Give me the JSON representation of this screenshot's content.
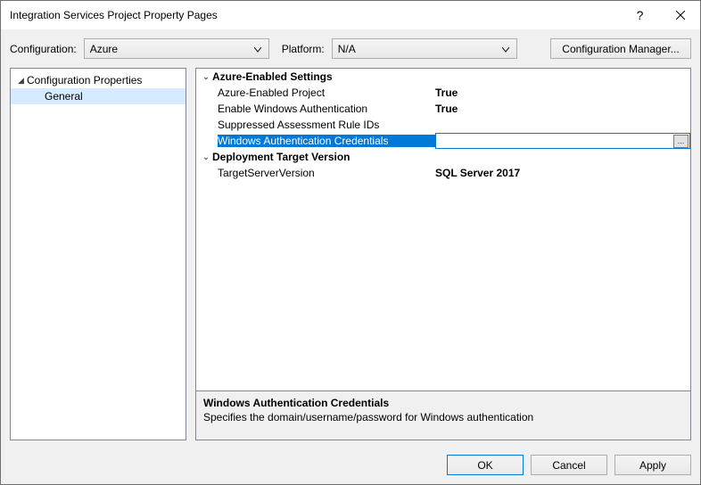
{
  "window": {
    "title": "Integration Services Project Property Pages"
  },
  "titlebar": {
    "help": "?",
    "close": "×"
  },
  "toolbar": {
    "configuration_label": "Configuration:",
    "configuration_value": "Azure",
    "platform_label": "Platform:",
    "platform_value": "N/A",
    "cfgmgr_label": "Configuration Manager..."
  },
  "tree": {
    "root": "Configuration Properties",
    "selected": "General"
  },
  "grid": {
    "cat1": "Azure-Enabled Settings",
    "p1": {
      "name": "Azure-Enabled Project",
      "value": "True"
    },
    "p2": {
      "name": "Enable Windows Authentication",
      "value": "True"
    },
    "p3": {
      "name": "Suppressed Assessment Rule IDs",
      "value": ""
    },
    "p4": {
      "name": "Windows Authentication Credentials",
      "value": ""
    },
    "ellipsis": "...",
    "cat2": "Deployment Target Version",
    "p5": {
      "name": "TargetServerVersion",
      "value": "SQL Server 2017"
    }
  },
  "desc": {
    "title": "Windows Authentication Credentials",
    "text": "Specifies the domain/username/password for Windows authentication"
  },
  "footer": {
    "ok": "OK",
    "cancel": "Cancel",
    "apply": "Apply"
  }
}
